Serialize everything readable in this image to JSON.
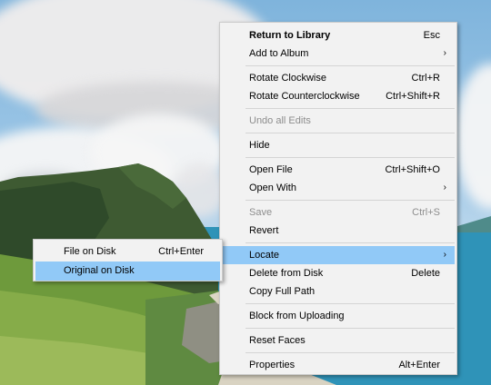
{
  "main_menu": {
    "items": [
      {
        "label": "Return to Library",
        "shortcut": "Esc"
      },
      {
        "label": "Add to Album",
        "shortcut": ""
      },
      {
        "label": "Rotate Clockwise",
        "shortcut": "Ctrl+R"
      },
      {
        "label": "Rotate Counterclockwise",
        "shortcut": "Ctrl+Shift+R"
      },
      {
        "label": "Undo all Edits",
        "shortcut": ""
      },
      {
        "label": "Hide",
        "shortcut": ""
      },
      {
        "label": "Open File",
        "shortcut": "Ctrl+Shift+O"
      },
      {
        "label": "Open With",
        "shortcut": ""
      },
      {
        "label": "Save",
        "shortcut": "Ctrl+S"
      },
      {
        "label": "Revert",
        "shortcut": ""
      },
      {
        "label": "Locate",
        "shortcut": ""
      },
      {
        "label": "Delete from Disk",
        "shortcut": "Delete"
      },
      {
        "label": "Copy Full Path",
        "shortcut": ""
      },
      {
        "label": "Block from Uploading",
        "shortcut": ""
      },
      {
        "label": "Reset Faces",
        "shortcut": ""
      },
      {
        "label": "Properties",
        "shortcut": "Alt+Enter"
      }
    ],
    "submenu_arrow": "›"
  },
  "locate_submenu": {
    "items": [
      {
        "label": "File on Disk",
        "shortcut": "Ctrl+Enter"
      },
      {
        "label": "Original on Disk",
        "shortcut": ""
      }
    ]
  },
  "colors": {
    "menu_background": "#f2f2f2",
    "highlight": "#91c9f7",
    "disabled_text": "#8d8d8d"
  }
}
